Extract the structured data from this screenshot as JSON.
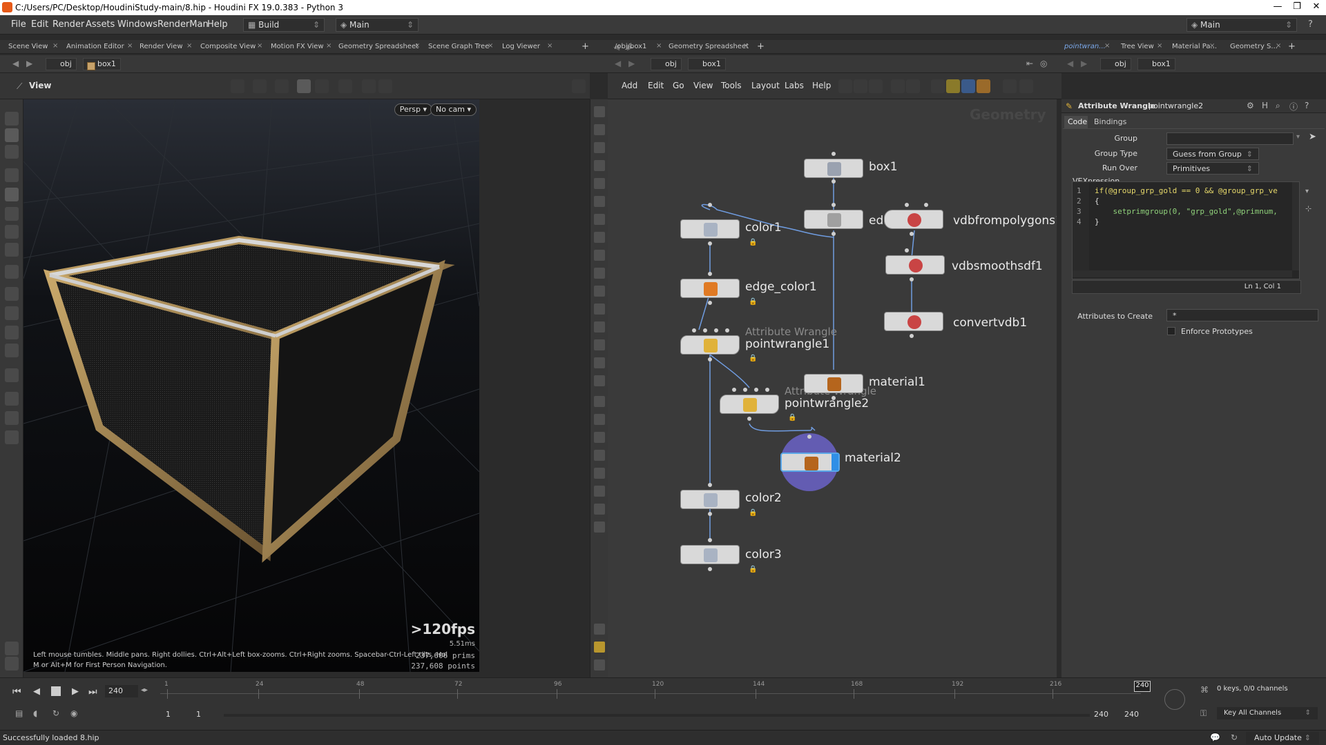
{
  "window": {
    "title": "C:/Users/PC/Desktop/HoudiniStudy-main/8.hip - Houdini FX 19.0.383 - Python 3"
  },
  "menubar": {
    "items": [
      "File",
      "Edit",
      "Render",
      "Assets",
      "Windows",
      "RenderMan",
      "Help"
    ],
    "desktop": "Build",
    "context": "Main",
    "right_context": "Main"
  },
  "left_pane": {
    "tabs": [
      "Scene View",
      "Animation Editor",
      "Render View",
      "Composite View",
      "Motion FX View",
      "Geometry Spreadsheet",
      "Scene Graph Tree",
      "Log Viewer"
    ],
    "path": [
      "obj",
      "box1"
    ],
    "view_label": "View",
    "camera_menu": "Persp ▾",
    "cam_menu": "No cam ▾",
    "fps": ">120fps",
    "ms": "5.51ms",
    "prims": "237,606  prims",
    "points": "237,608  points",
    "hint_line1": "Left mouse tumbles. Middle pans. Right dollies. Ctrl+Alt+Left box-zooms. Ctrl+Right zooms. Spacebar-Ctrl-Left tilts. Hold L for alternate tumbl...",
    "hint_line2": "M or Alt+M for First Person Navigation."
  },
  "network": {
    "tabs": [
      "/obj/box1",
      "Geometry Spreadsheet"
    ],
    "path": [
      "obj",
      "box1"
    ],
    "menu": [
      "Add",
      "Edit",
      "Go",
      "View",
      "Tools",
      "Layout",
      "Labs",
      "Help"
    ],
    "context_watermark": "Geometry",
    "nodes": [
      {
        "name": "box1",
        "type": "box"
      },
      {
        "name": "color1",
        "type": "color"
      },
      {
        "name": "edit",
        "type": "edit"
      },
      {
        "name": "vdbfrompolygons1",
        "type": "vdb"
      },
      {
        "name": "vdbsmoothsdf1",
        "type": "vdb"
      },
      {
        "name": "convertvdb1",
        "type": "vdb"
      },
      {
        "name": "edge_color1",
        "type": "edge"
      },
      {
        "name": "pointwrangle1",
        "type": "wrangle",
        "subtitle": "Attribute Wrangle"
      },
      {
        "name": "pointwrangle2",
        "type": "wrangle",
        "subtitle": "Attribute Wrangle"
      },
      {
        "name": "material1",
        "type": "material"
      },
      {
        "name": "material2",
        "type": "material"
      },
      {
        "name": "color2",
        "type": "color"
      },
      {
        "name": "color3",
        "type": "color"
      }
    ]
  },
  "params": {
    "tabs_top": [
      "pointwran...",
      "Tree View",
      "Material Pa...",
      "Geometry S..."
    ],
    "path": [
      "obj",
      "box1"
    ],
    "node_type": "Attribute Wrangle",
    "node_name": "pointwrangle2",
    "sub_tabs": [
      "Code",
      "Bindings"
    ],
    "group_label": "Group",
    "group_value": "",
    "group_type_label": "Group Type",
    "group_type_value": "Guess from Group",
    "run_over_label": "Run Over",
    "run_over_value": "Primitives",
    "vex_label": "VEXpression",
    "code_lines": [
      {
        "n": "1",
        "text": "if(@group_grp_gold == 0 && @group_grp_ve"
      },
      {
        "n": "2",
        "text": "{"
      },
      {
        "n": "3",
        "text": "    setprimgroup(0, \"grp_gold\",@primnum,"
      },
      {
        "n": "4",
        "text": "}"
      }
    ],
    "cursor_pos": "Ln 1, Col 1",
    "attr_create_label": "Attributes to Create",
    "attr_create_value": "*",
    "enforce_label": "Enforce Prototypes"
  },
  "timeline": {
    "frame": "240",
    "ticks": [
      "1",
      "24",
      "48",
      "72",
      "96",
      "120",
      "144",
      "168",
      "192",
      "216"
    ],
    "current_marker": "240",
    "start": "1",
    "start2": "1",
    "end": "240",
    "end2": "240",
    "keys": "0 keys, 0/0 channels",
    "key_all": "Key All Channels",
    "auto_update": "Auto Update"
  },
  "status": {
    "message": "Successfully loaded 8.hip"
  }
}
